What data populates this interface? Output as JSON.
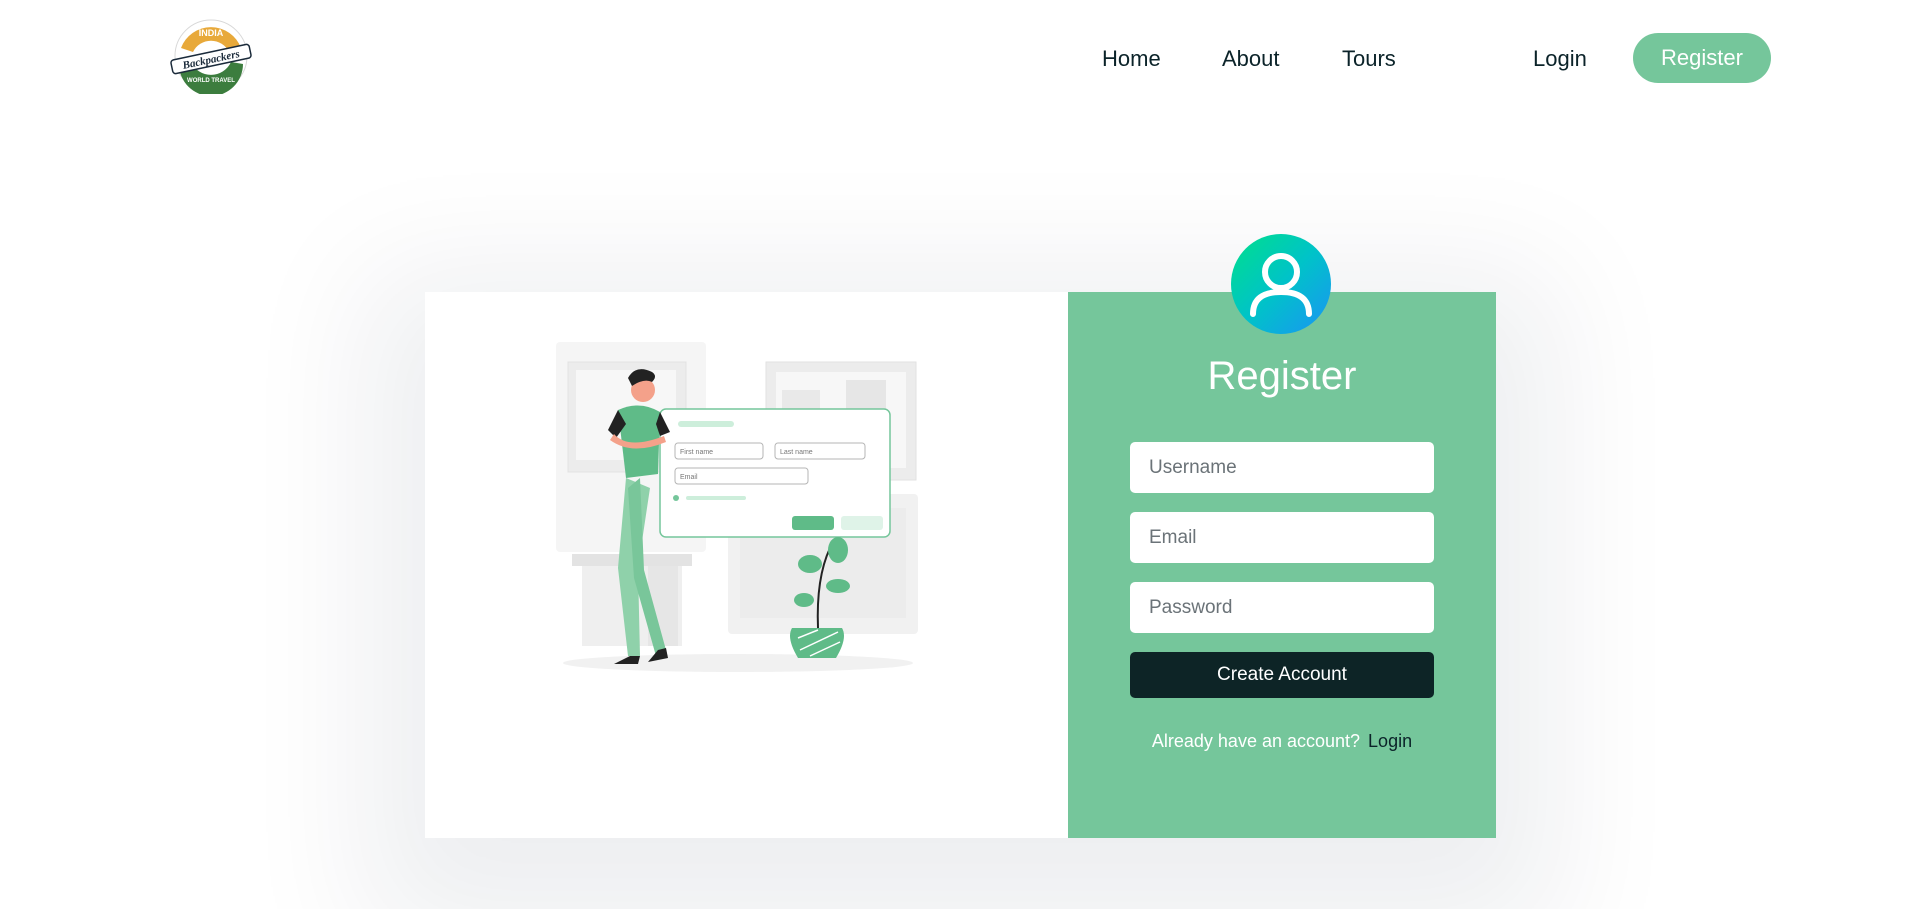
{
  "brand": {
    "logo_top": "INDIA",
    "logo_main": "Backpackers",
    "logo_bottom": "WORLD TRAVEL"
  },
  "nav": {
    "home": "Home",
    "about": "About",
    "tours": "Tours",
    "login": "Login",
    "register": "Register"
  },
  "illustration": {
    "first_name": "First name",
    "last_name": "Last name",
    "email": "Email"
  },
  "form": {
    "title": "Register",
    "username_placeholder": "Username",
    "email_placeholder": "Email",
    "password_placeholder": "Password",
    "submit_label": "Create Account",
    "footer_text": "Already have an account?",
    "footer_link": "Login"
  },
  "colors": {
    "accent": "#75c69b",
    "dark": "#0d2426",
    "avatar_gradient_start": "#00e08a",
    "avatar_gradient_end": "#1b93f5"
  },
  "icons": {
    "avatar": "user-icon"
  }
}
